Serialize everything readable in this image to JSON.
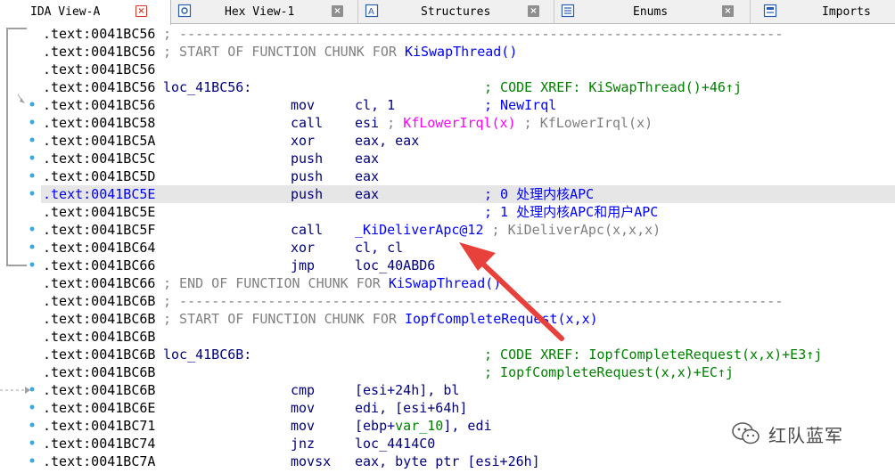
{
  "tabs": [
    {
      "label": "IDA View-A",
      "active": true
    },
    {
      "label": "Hex View-1",
      "active": false
    },
    {
      "label": "Structures",
      "active": false
    },
    {
      "label": "Enums",
      "active": false
    },
    {
      "label": "Imports",
      "active": false
    }
  ],
  "lines": [
    {
      "addr": ".text:0041BC56",
      "sep": "; ---------------------------------------------------------------------------"
    },
    {
      "addr": ".text:0041BC56",
      "sep_pre": "; START OF FUNCTION CHUNK FOR ",
      "sep_fn": "KiSwapThread()"
    },
    {
      "addr": ".text:0041BC56"
    },
    {
      "addr": ".text:0041BC56",
      "label": "loc_41BC56:",
      "xref": "; CODE XREF: KiSwapThread()+46↑j"
    },
    {
      "addr": ".text:0041BC56",
      "mn": "mov",
      "op": "cl, 1",
      "cmt": "; NewIrql"
    },
    {
      "addr": ".text:0041BC58",
      "mn": "call",
      "op_pre": "esi ",
      "op_grey1": "; ",
      "op_mag": "KfLowerIrql(x)",
      "op_grey2": " ; KfLowerIrql(x)"
    },
    {
      "addr": ".text:0041BC5A",
      "mn": "xor",
      "op": "eax, eax"
    },
    {
      "addr": ".text:0041BC5C",
      "mn": "push",
      "op": "eax"
    },
    {
      "addr": ".text:0041BC5D",
      "mn": "push",
      "op": "eax"
    },
    {
      "addr": ".text:0041BC5E",
      "mn": "push",
      "op": "eax",
      "cmt": "; 0 处理内核APC",
      "highlight": true
    },
    {
      "addr": ".text:0041BC5E",
      "cmt": "; 1 处理内核APC和用户APC"
    },
    {
      "addr": ".text:0041BC5F",
      "mn": "call",
      "op_fn": "_KiDeliverApc@12",
      "op_grey2": " ; KiDeliverApc(x,x,x)"
    },
    {
      "addr": ".text:0041BC64",
      "mn": "xor",
      "op": "cl, cl"
    },
    {
      "addr": ".text:0041BC66",
      "mn": "jmp",
      "op": "loc_40ABD6"
    },
    {
      "addr": ".text:0041BC66",
      "sep_pre": "; END OF FUNCTION CHUNK FOR ",
      "sep_fn": "KiSwapThread()"
    },
    {
      "addr": ".text:0041BC6B",
      "sep": "; ---------------------------------------------------------------------------"
    },
    {
      "addr": ".text:0041BC6B",
      "sep_pre": "; START OF FUNCTION CHUNK FOR ",
      "sep_fn": "IopfCompleteRequest(x,x)"
    },
    {
      "addr": ".text:0041BC6B"
    },
    {
      "addr": ".text:0041BC6B",
      "label": "loc_41BC6B:",
      "xref": "; CODE XREF: IopfCompleteRequest(x,x)+E3↑j"
    },
    {
      "addr": ".text:0041BC6B",
      "xref": "; IopfCompleteRequest(x,x)+EC↑j"
    },
    {
      "addr": ".text:0041BC6B",
      "mn": "cmp",
      "op_pre": "[esi+24h], bl"
    },
    {
      "addr": ".text:0041BC6E",
      "mn": "mov",
      "op_pre": "edi, [esi+64h]"
    },
    {
      "addr": ".text:0041BC71",
      "mn": "mov",
      "op_pre": "[ebp+",
      "op_var": "var_10",
      "op_post": "], edi"
    },
    {
      "addr": ".text:0041BC74",
      "mn": "jnz",
      "op": "loc_4414C0"
    },
    {
      "addr": ".text:0041BC7A",
      "mn": "movsx",
      "op": "eax, byte ptr [esi+26h]"
    }
  ],
  "watermark": {
    "text": "红队蓝军",
    "icon": "wechat-icon"
  },
  "colors": {
    "arrow": "#e8403a",
    "highlight_row": "#e6e6e6",
    "gutter_dot": "#39a9e0"
  }
}
